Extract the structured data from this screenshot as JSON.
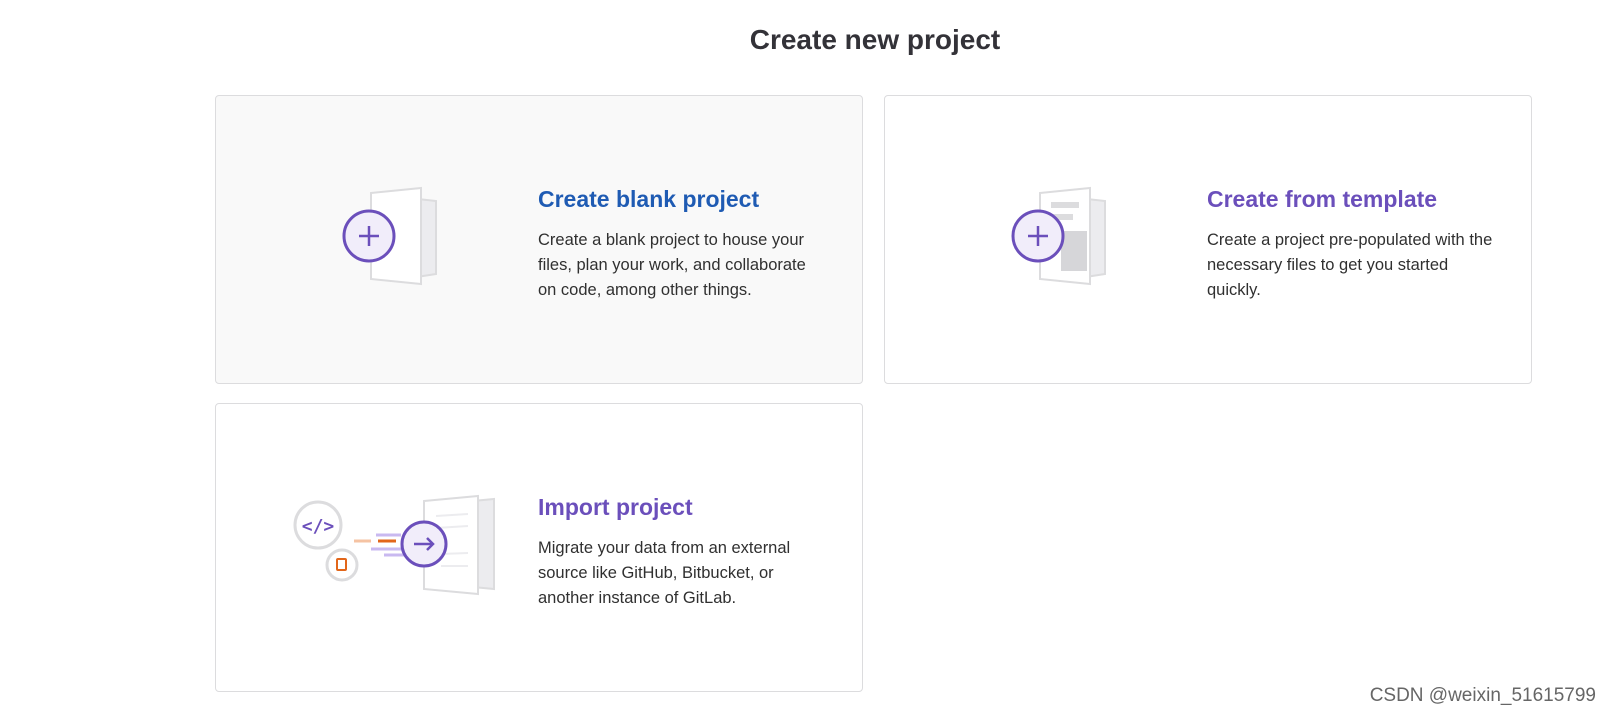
{
  "page": {
    "title": "Create new project"
  },
  "cards": [
    {
      "title": "Create blank project",
      "description": "Create a blank project to house your files, plan your work, and collaborate on code, among other things.",
      "icon": "blank-project-icon"
    },
    {
      "title": "Create from template",
      "description": "Create a project pre-populated with the necessary files to get you started quickly.",
      "icon": "template-project-icon"
    },
    {
      "title": "Import project",
      "description": "Migrate your data from an external source like GitHub, Bitbucket, or another instance of GitLab.",
      "icon": "import-project-icon"
    }
  ],
  "watermark": "CSDN @weixin_51615799",
  "colors": {
    "accent_purple": "#6b4fbb",
    "link_blue": "#1f5bb3",
    "orange": "#e2661a"
  }
}
